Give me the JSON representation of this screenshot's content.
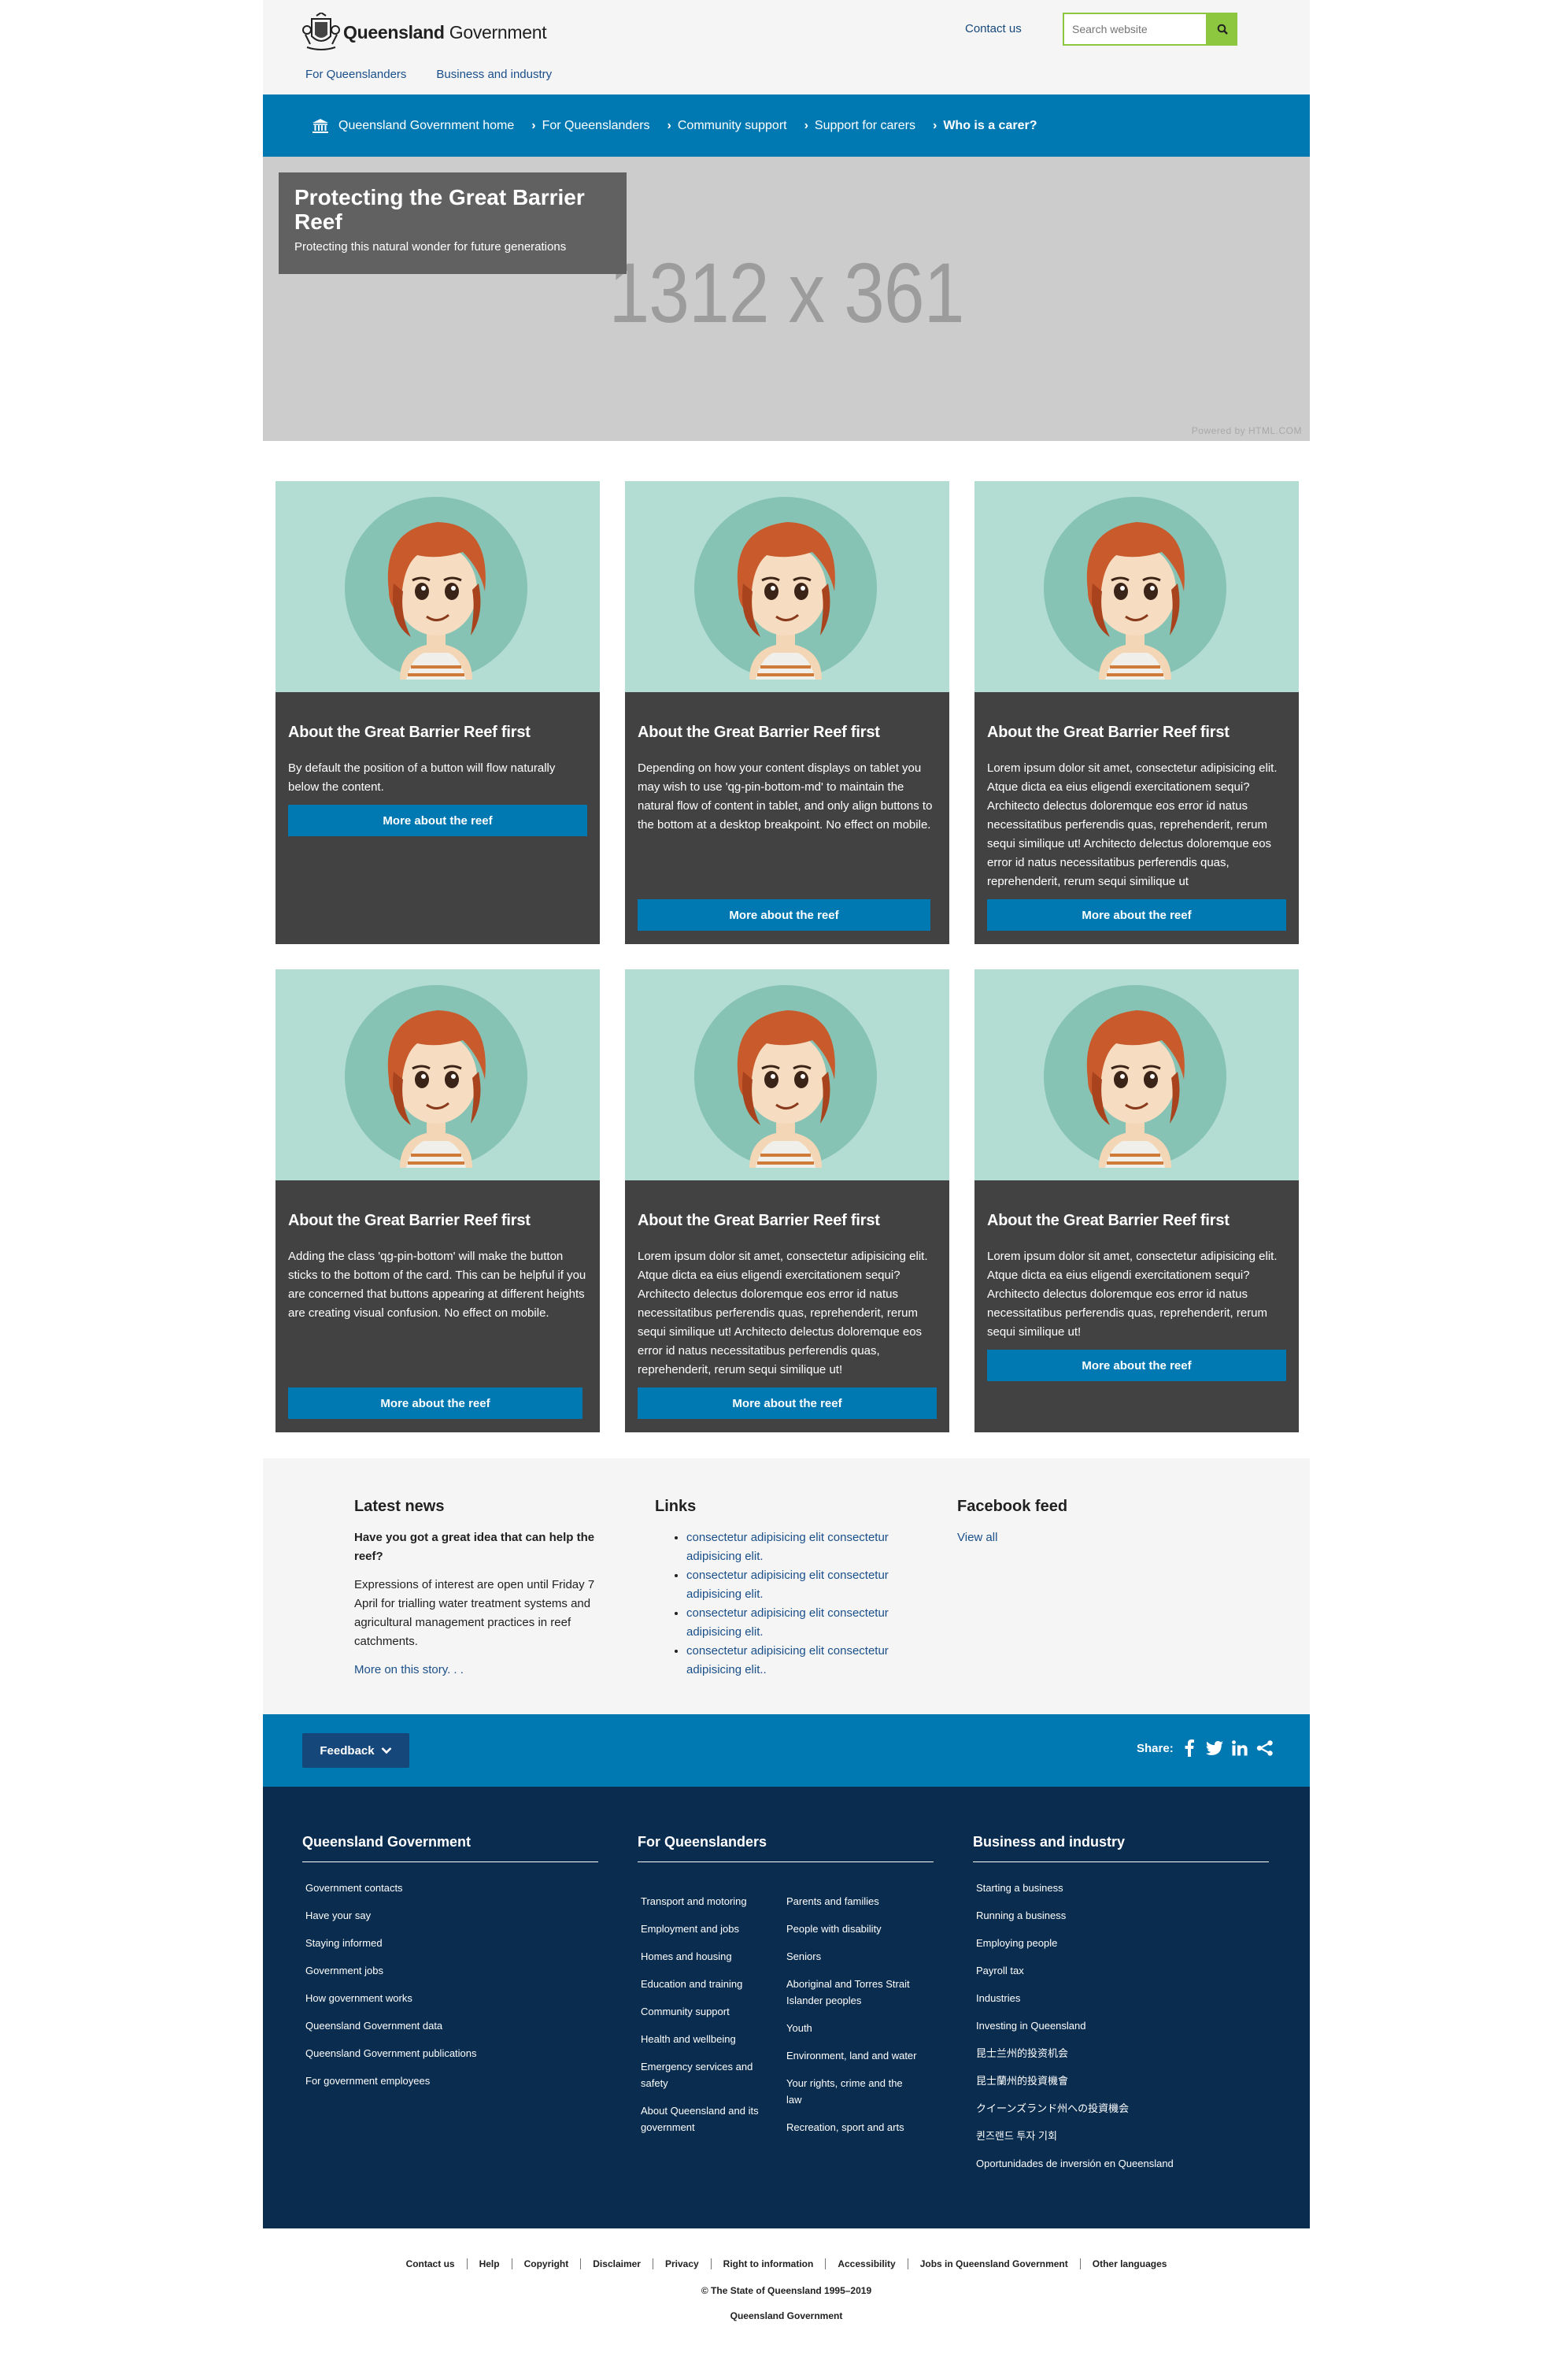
{
  "header": {
    "logo_bold": "Queensland",
    "logo_light": "Government",
    "contact_link": "Contact us",
    "search_placeholder": "Search website",
    "top_nav": [
      "For Queenslanders",
      "Business and industry"
    ]
  },
  "breadcrumb": {
    "items": [
      "Queensland Government home",
      "For Queenslanders",
      "Community support",
      "Support for carers",
      "Who is a carer?"
    ]
  },
  "hero": {
    "placeholder_text": "1312 x 361",
    "powered_text": "Powered by HTML.COM",
    "title": "Protecting the Great Barrier Reef",
    "subtitle": "Protecting this natural wonder for future generations"
  },
  "cards": [
    {
      "title": "About the Great Barrier Reef first",
      "text": "By default the position of a button will flow naturally below the content.",
      "button": "More about the reef"
    },
    {
      "title": "About the Great Barrier Reef first",
      "text": "Depending on how your content displays on tablet you may wish to use 'qg-pin-bottom-md' to maintain the natural flow of content in tablet, and only align buttons to the bottom at a desktop breakpoint. No effect on mobile.",
      "button": "More about the reef"
    },
    {
      "title": "About the Great Barrier Reef first",
      "text": "Lorem ipsum dolor sit amet, consectetur adipisicing elit. Atque dicta ea eius eligendi exercitationem sequi? Architecto delectus doloremque eos error id natus necessitatibus perferendis quas, reprehenderit, rerum sequi similique ut! Architecto delectus doloremque eos error id natus necessitatibus perferendis quas, reprehenderit, rerum sequi similique ut",
      "button": "More about the reef"
    },
    {
      "title": "About the Great Barrier Reef first",
      "text": "Adding the class 'qg-pin-bottom' will make the button sticks to the bottom of the card. This can be helpful if you are concerned that buttons appearing at different heights are creating visual confusion. No effect on mobile.",
      "button": "More about the reef"
    },
    {
      "title": "About the Great Barrier Reef first",
      "text": "Lorem ipsum dolor sit amet, consectetur adipisicing elit. Atque dicta ea eius eligendi exercitationem sequi? Architecto delectus doloremque eos error id natus necessitatibus perferendis quas, reprehenderit, rerum sequi similique ut! Architecto delectus doloremque eos error id natus necessitatibus perferendis quas, reprehenderit, rerum sequi similique ut!",
      "button": "More about the reef"
    },
    {
      "title": "About the Great Barrier Reef first",
      "text": "Lorem ipsum dolor sit amet, consectetur adipisicing elit. Atque dicta ea eius eligendi exercitationem sequi? Architecto delectus doloremque eos error id natus necessitatibus perferendis quas, reprehenderit, rerum sequi similique ut!",
      "button": "More about the reef"
    }
  ],
  "related": {
    "news": {
      "heading": "Latest news",
      "headline": "Have you got a great idea that can help the reef?",
      "text": "Expressions of interest are open until Friday 7 April for trialling water treatment systems and agricultural management practices in reef catchments.",
      "more": "More on this story. . ."
    },
    "links": {
      "heading": "Links",
      "items": [
        "consectetur adipisicing elit consectetur adipisicing elit.",
        "consectetur adipisicing elit consectetur adipisicing elit.",
        "consectetur adipisicing elit consectetur adipisicing elit.",
        "consectetur adipisicing elit consectetur adipisicing elit.."
      ]
    },
    "facebook": {
      "heading": "Facebook feed",
      "view_all": "View all"
    }
  },
  "sharebar": {
    "feedback": "Feedback",
    "share_label": "Share:"
  },
  "footer": {
    "qg": {
      "heading": "Queensland Government",
      "links": [
        "Government contacts",
        "Have your say",
        "Staying informed",
        "Government jobs",
        "How government works",
        "Queensland Government data",
        "Queensland Government publications",
        "For government employees"
      ]
    },
    "fq": {
      "heading": "For Queenslanders",
      "col1": [
        "Transport and motoring",
        "Employment and jobs",
        "Homes and housing",
        "Education and training",
        "Community support",
        "Health and wellbeing",
        "Emergency services and safety",
        "About Queensland and its government"
      ],
      "col2": [
        "Parents and families",
        "People with disability",
        "Seniors",
        "Aboriginal and Torres Strait Islander peoples",
        "Youth",
        "Environment, land and water",
        "Your rights, crime and the law",
        "Recreation, sport and arts"
      ]
    },
    "bi": {
      "heading": "Business and industry",
      "links": [
        "Starting a business",
        "Running a business",
        "Employing people",
        "Payroll tax",
        "Industries",
        "Investing in Queensland",
        "昆士兰州的投资机会",
        "昆士蘭州的投資機會",
        "クイーンズランド州への投資機会",
        "퀸즈랜드 투자 기회",
        "Oportunidades de inversión en Queensland"
      ]
    }
  },
  "bottom": {
    "links": [
      "Contact us",
      "Help",
      "Copyright",
      "Disclaimer",
      "Privacy",
      "Right to information",
      "Accessibility",
      "Jobs in Queensland Government",
      "Other languages"
    ],
    "copyright": "© The State of Queensland 1995–2019",
    "gov_name": "Queensland Government"
  }
}
